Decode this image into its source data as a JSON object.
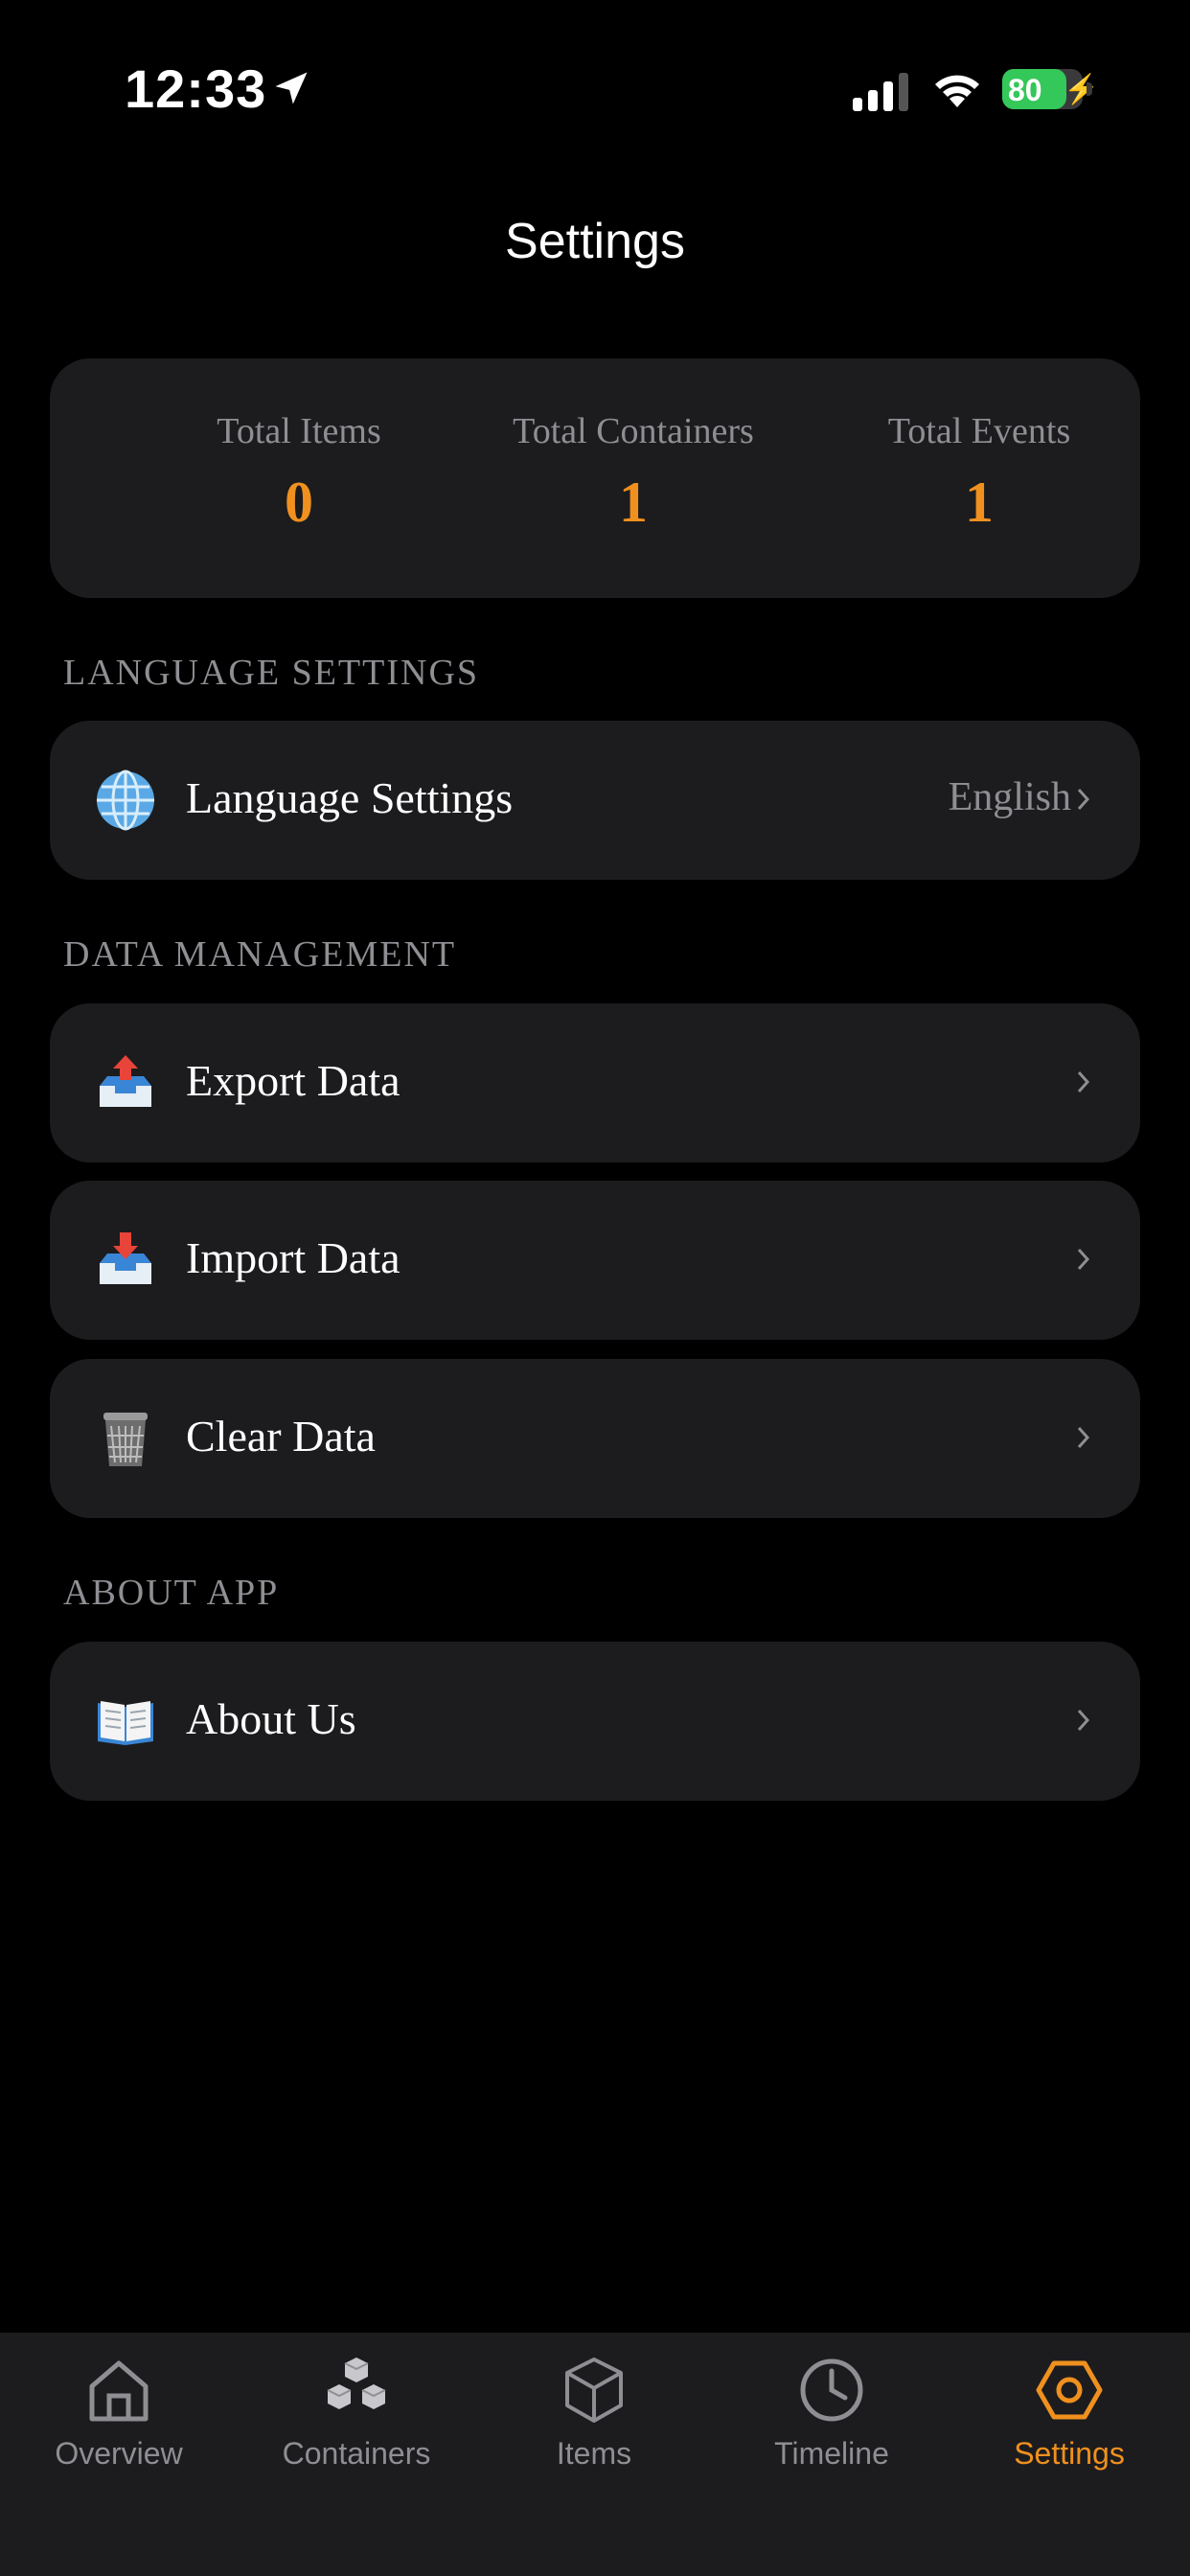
{
  "status_bar": {
    "time": "12:33",
    "battery": "80",
    "icons": [
      "location-arrow-icon",
      "cellular-signal-icon",
      "wifi-icon",
      "battery-icon"
    ]
  },
  "header": {
    "title": "Settings"
  },
  "stats": [
    {
      "label": "Total Items",
      "value": "0"
    },
    {
      "label": "Total Containers",
      "value": "1"
    },
    {
      "label": "Total Events",
      "value": "1"
    }
  ],
  "sections": {
    "language": {
      "header": "LANGUAGE SETTINGS",
      "rows": [
        {
          "label": "Language Settings",
          "value": "English",
          "icon": "globe-icon"
        }
      ]
    },
    "data": {
      "header": "DATA MANAGEMENT",
      "rows": [
        {
          "label": "Export Data",
          "icon": "outbox-tray-icon"
        },
        {
          "label": "Import Data",
          "icon": "inbox-tray-icon"
        },
        {
          "label": "Clear Data",
          "icon": "wastebasket-icon"
        }
      ]
    },
    "about": {
      "header": "ABOUT APP",
      "rows": [
        {
          "label": "About Us",
          "icon": "open-book-icon"
        }
      ]
    }
  },
  "tabs": [
    {
      "label": "Overview",
      "icon": "house-icon"
    },
    {
      "label": "Containers",
      "icon": "cubes-icon"
    },
    {
      "label": "Items",
      "icon": "box-icon"
    },
    {
      "label": "Timeline",
      "icon": "clock-icon"
    },
    {
      "label": "Settings",
      "icon": "hexagon-gear-icon",
      "active": true
    }
  ],
  "colors": {
    "accent": "#f0901e",
    "card": "#1c1c1e",
    "secondary_text": "#8e8e93",
    "battery": "#34c759"
  }
}
